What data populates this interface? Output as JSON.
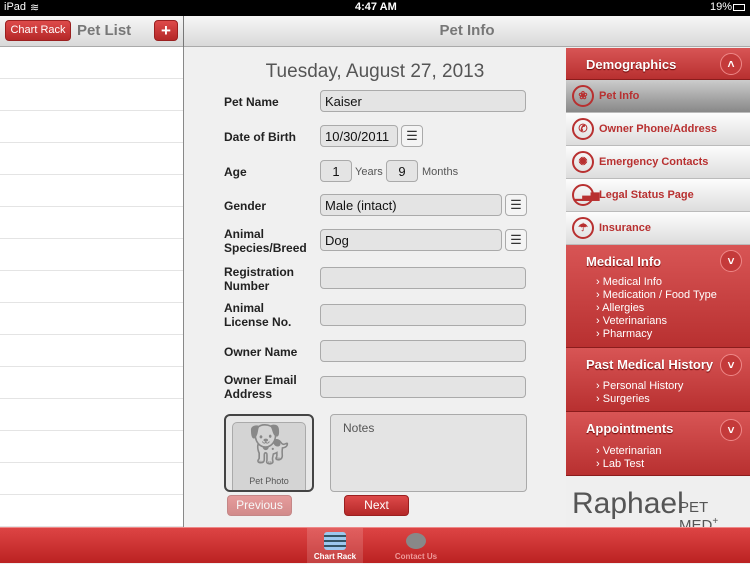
{
  "status": {
    "device": "iPad",
    "time": "4:47 AM",
    "battery": "19%"
  },
  "nav": {
    "chart_rack": "Chart Rack",
    "left_title": "Pet List",
    "add": "+",
    "title": "Pet Info"
  },
  "form": {
    "date": "Tuesday, August 27, 2013",
    "pet_name_label": "Pet Name",
    "pet_name": "Kaiser",
    "dob_label": "Date of Birth",
    "dob": "10/30/2011",
    "age_label": "Age",
    "age_years": "1",
    "years": "Years",
    "age_months": "9",
    "months": "Months",
    "gender_label": "Gender",
    "gender": "Male (intact)",
    "species_label": "Animal Species/Breed",
    "species": "Dog",
    "reg_label": "Registration Number",
    "reg": "",
    "license_label": "Animal License No.",
    "license": "",
    "owner_label": "Owner Name",
    "owner": "",
    "email_label": "Owner Email Address",
    "email": "",
    "photo_label": "Pet Photo",
    "notes_placeholder": "Notes",
    "previous": "Previous",
    "next": "Next"
  },
  "sidebar": {
    "demographics": "Demographics",
    "items": [
      {
        "label": "Pet Info",
        "icon": "paw-icon"
      },
      {
        "label": "Owner Phone/Address",
        "icon": "phone-icon"
      },
      {
        "label": "Emergency Contacts",
        "icon": "siren-icon"
      },
      {
        "label": "Legal Status Page",
        "icon": "signal-bars-icon"
      },
      {
        "label": "Insurance",
        "icon": "umbrella-icon"
      }
    ],
    "medical": {
      "title": "Medical Info",
      "items": [
        "Medical Info",
        "Medication / Food Type",
        "Allergies",
        "Veterinarians",
        "Pharmacy"
      ]
    },
    "history": {
      "title": "Past Medical History",
      "items": [
        "Personal History",
        "Surgeries"
      ]
    },
    "appointments": {
      "title": "Appointments",
      "items": [
        "Veterinarian",
        "Lab Test"
      ]
    },
    "logo": "Raphael PET MED+"
  },
  "tabs": [
    {
      "label": "Chart Rack"
    },
    {
      "label": "Contact Us"
    }
  ],
  "colors": {
    "accent": "#c43535"
  }
}
